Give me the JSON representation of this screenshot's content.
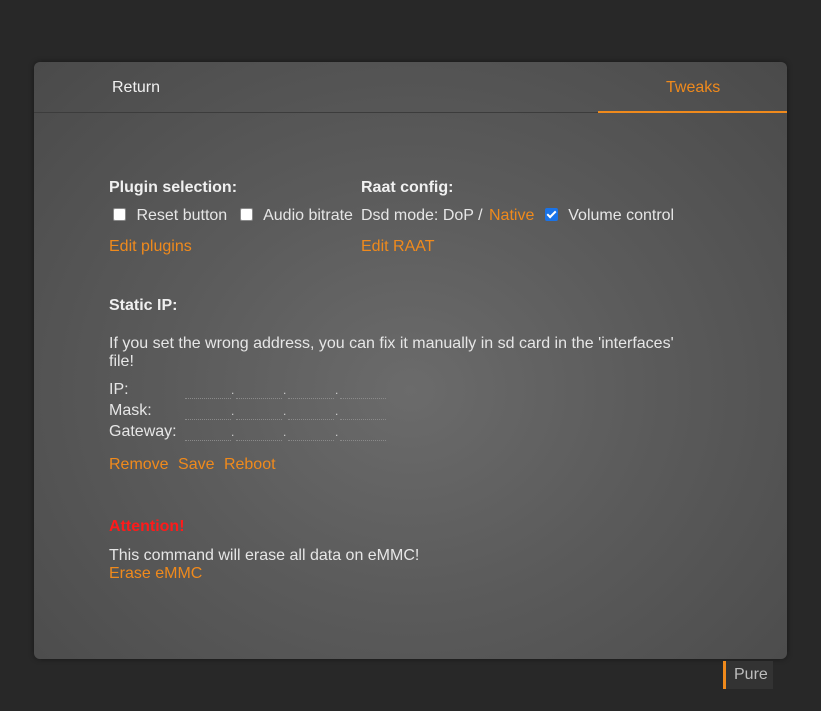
{
  "tabs": {
    "return_label": "Return",
    "tweaks_label": "Tweaks"
  },
  "plugin": {
    "heading": "Plugin selection:",
    "reset_label": "Reset button",
    "reset_checked": false,
    "audio_label": "Audio bitrate",
    "audio_checked": false,
    "edit_link": "Edit plugins"
  },
  "raat": {
    "heading": "Raat config:",
    "dsd_prefix": "Dsd mode: DoP /",
    "dsd_native": "Native",
    "volume_label": "Volume control",
    "volume_checked": true,
    "edit_link": "Edit RAAT"
  },
  "static_ip": {
    "heading": "Static IP:",
    "note": "If you set the wrong address, you can fix it manually in sd card in the 'interfaces' file!",
    "ip_label": "IP:",
    "mask_label": "Mask:",
    "gateway_label": "Gateway:",
    "separator": ".",
    "remove_link": "Remove",
    "save_link": "Save",
    "reboot_link": "Reboot"
  },
  "emmc": {
    "attention": "Attention!",
    "warning": "This command will erase all data on eMMC!",
    "erase_link": "Erase eMMC"
  },
  "footer": {
    "mode_label": "Pure"
  },
  "colors": {
    "accent": "#f08a1c",
    "attention": "#ff1a1a",
    "checkbox_checked": "#1a73e8"
  }
}
